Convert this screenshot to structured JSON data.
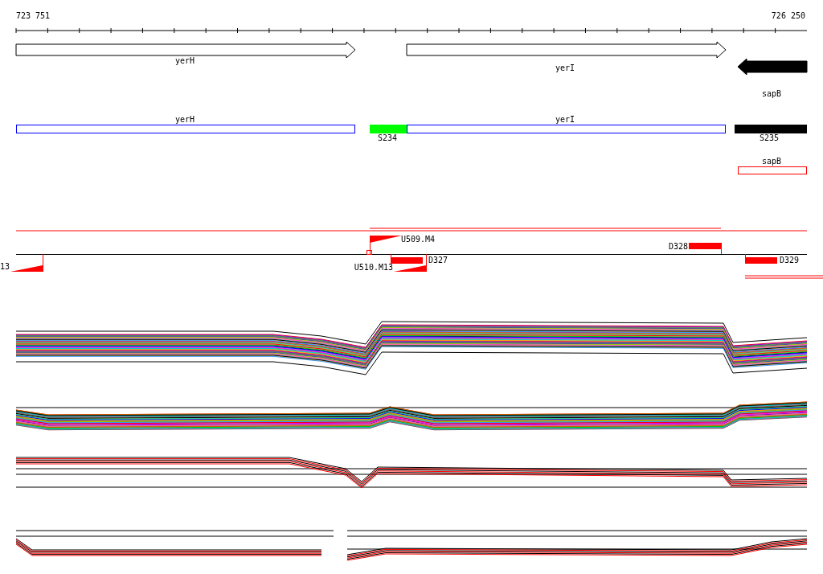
{
  "ruler": {
    "start_label": "723 751",
    "end_label": "726 250"
  },
  "genes": [
    {
      "label": "yerH",
      "kind": "forward"
    },
    {
      "label": "yerI",
      "kind": "forward"
    },
    {
      "label": "sapB",
      "kind": "reverse"
    }
  ],
  "segments": [
    {
      "label": "yerH",
      "kind": "outline",
      "color": "#0000ff"
    },
    {
      "label": "S234",
      "kind": "filled",
      "color": "#00ff00"
    },
    {
      "label": "yerI",
      "kind": "outline",
      "color": "#0000ff"
    },
    {
      "label": "S235",
      "kind": "filled",
      "color": "#000000"
    }
  ],
  "transcript": {
    "label": "sapB",
    "color": "#ff0000"
  },
  "probes": [
    {
      "label": "U509.M4",
      "kind": "wedge"
    },
    {
      "label": "D328",
      "kind": "bar"
    },
    {
      "label": "13",
      "kind": "wedge"
    },
    {
      "label": "D327",
      "kind": "bar"
    },
    {
      "label": "U510.M13",
      "kind": "wedge"
    },
    {
      "label": "D329",
      "kind": "bar"
    }
  ]
}
